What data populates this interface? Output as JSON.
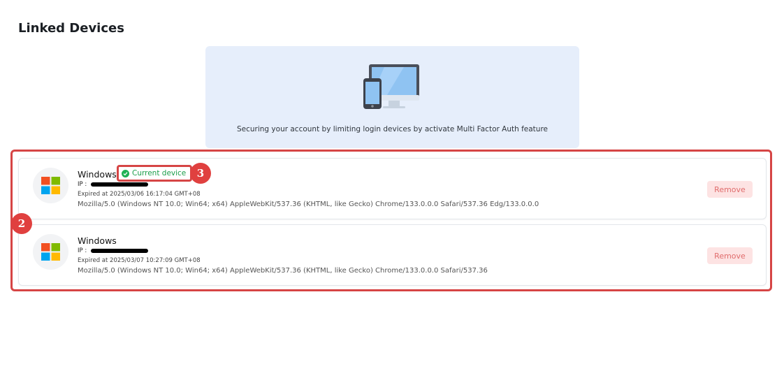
{
  "page": {
    "title": "Linked Devices"
  },
  "banner": {
    "illustration_icon": "devices-illustration",
    "text": "Securing your account by limiting login devices by activate Multi Factor Auth feature"
  },
  "devices": [
    {
      "os": "Windows",
      "icon": "windows-logo-icon",
      "current_device_label": "Current device",
      "ip_label": "IP :",
      "expired": "Expired at 2025/03/06 16:17:04 GMT+08",
      "user_agent": "Mozilla/5.0 (Windows NT 10.0; Win64; x64) AppleWebKit/537.36 (KHTML, like Gecko) Chrome/133.0.0.0 Safari/537.36 Edg/133.0.0.0",
      "remove_label": "Remove"
    },
    {
      "os": "Windows",
      "icon": "windows-logo-icon",
      "ip_label": "IP :",
      "expired": "Expired at 2025/03/07 10:27:09 GMT+08",
      "user_agent": "Mozilla/5.0 (Windows NT 10.0; Win64; x64) AppleWebKit/537.36 (KHTML, like Gecko) Chrome/133.0.0.0 Safari/537.36",
      "remove_label": "Remove"
    }
  ],
  "annotations": {
    "step_2": "2",
    "step_3": "3",
    "highlight_color": "#d64545"
  },
  "colors": {
    "banner_bg": "#e6eefb",
    "success": "#1fb155",
    "danger_bg": "#fde3e3",
    "danger_text": "#e06c6c"
  }
}
